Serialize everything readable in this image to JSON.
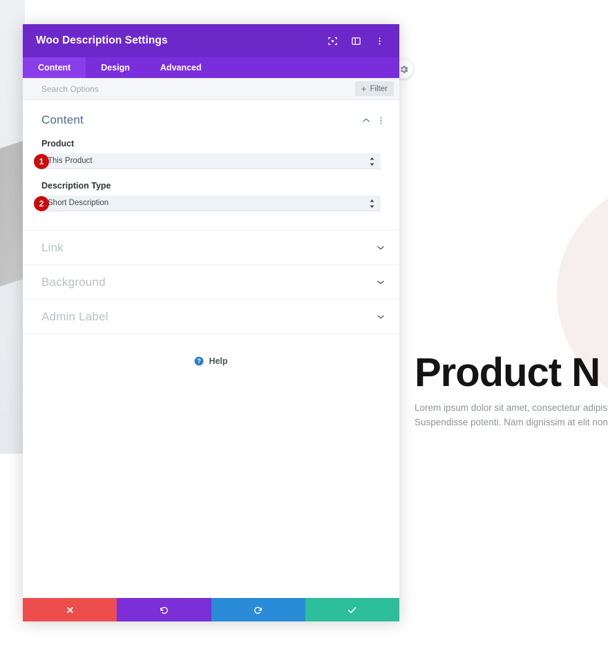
{
  "canvas": {
    "product_title": "Product N",
    "product_desc_line1": "Lorem ipsum dolor sit amet, consectetur adipiscing",
    "product_desc_line2": "Suspendisse potenti. Nam dignissim at elit non lobo",
    "settings_round_button": "settings-gear"
  },
  "modal": {
    "title": "Woo Description Settings",
    "header_icons": [
      {
        "name": "focus-target-icon",
        "label": "Focus"
      },
      {
        "name": "panel-layout-icon",
        "label": "Panel Layout"
      },
      {
        "name": "more-vertical-icon",
        "label": "More Options"
      }
    ],
    "tabs": [
      {
        "label": "Content",
        "active": true
      },
      {
        "label": "Design",
        "active": false
      },
      {
        "label": "Advanced",
        "active": false
      }
    ],
    "search": {
      "placeholder": "Search Options",
      "value": ""
    },
    "filter_button": {
      "label": "Filter",
      "plus": "+"
    },
    "sections": {
      "open": {
        "title": "Content",
        "collapse_icon": "chevron-up-icon",
        "menu_icon": "more-vertical-icon",
        "fields": [
          {
            "badge": "1",
            "label": "Product",
            "value": "This Product",
            "options": [
              "This Product"
            ]
          },
          {
            "badge": "2",
            "label": "Description Type",
            "value": "Short Description",
            "options": [
              "Short Description"
            ]
          }
        ]
      },
      "collapsed": [
        {
          "title": "Link",
          "icon": "chevron-down-icon"
        },
        {
          "title": "Background",
          "icon": "chevron-down-icon"
        },
        {
          "title": "Admin Label",
          "icon": "chevron-down-icon"
        }
      ]
    },
    "help": {
      "label": "Help",
      "icon": "help-circle-icon"
    },
    "footer_buttons": [
      {
        "name": "cancel-button",
        "icon": "close-x-icon",
        "color": "#ec4e4e"
      },
      {
        "name": "undo-button",
        "icon": "undo-icon",
        "color": "#7b2fd6"
      },
      {
        "name": "redo-button",
        "icon": "redo-icon",
        "color": "#2a8bd8"
      },
      {
        "name": "save-button",
        "icon": "check-icon",
        "color": "#2dbe9b"
      }
    ]
  },
  "colors": {
    "header_purple": "#6d28c9",
    "tabbar_purple": "#7a2edb",
    "tab_active_purple": "#8a3eea",
    "badge_red": "#cc0b0b",
    "section_title_blue": "#4a6d8c",
    "help_blue": "#2a7fc4"
  }
}
